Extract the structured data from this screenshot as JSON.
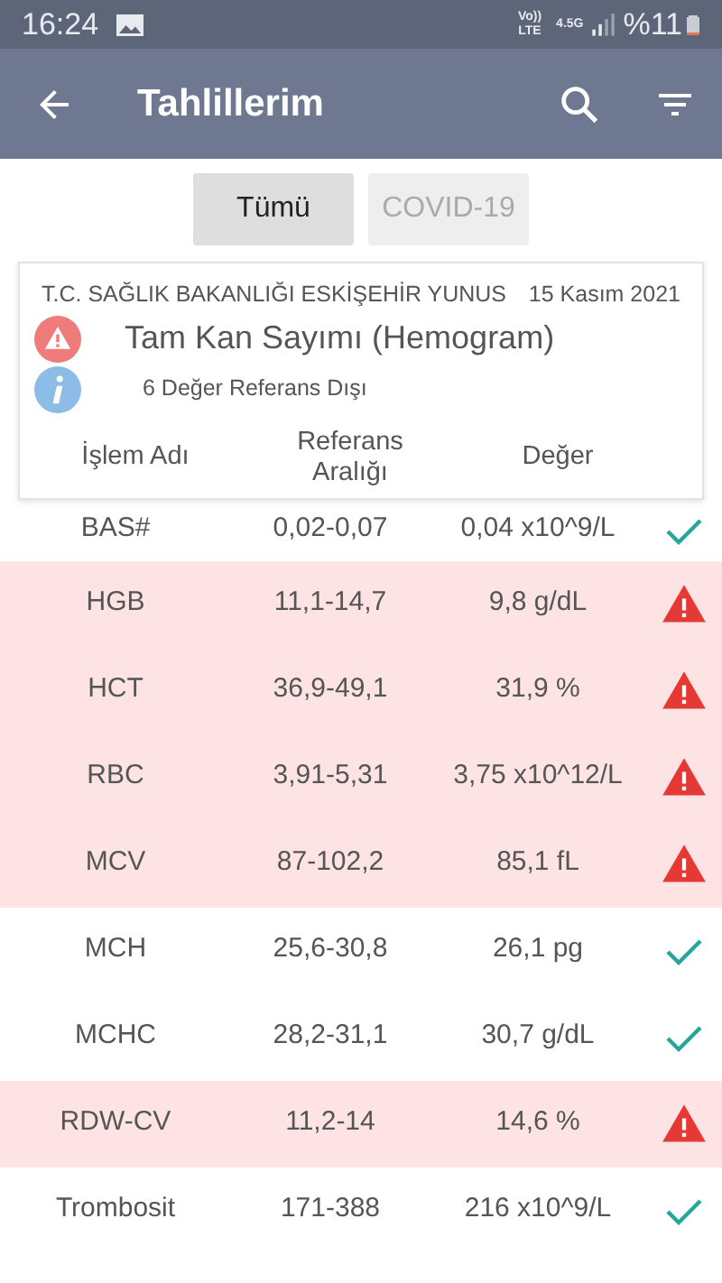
{
  "status_bar": {
    "time": "16:24",
    "volte": "Vo))",
    "lte": "LTE",
    "network": "4.5G",
    "battery": "%11"
  },
  "app_bar": {
    "title": "Tahlillerim"
  },
  "tabs": [
    {
      "label": "Tümü",
      "selected": true
    },
    {
      "label": "COVID-19",
      "selected": false
    }
  ],
  "card": {
    "institution": "T.C. SAĞLIK BAKANLIĞI ESKİŞEHİR YUNUS",
    "date": "15 Kasım 2021",
    "test_name": "Tam Kan Sayımı (Hemogram)",
    "summary": "6 Değer Referans Dışı",
    "columns": [
      "İşlem Adı",
      "Referans Aralığı",
      "Değer"
    ]
  },
  "rows": [
    {
      "name": "BAS#",
      "range": "0,02-0,07",
      "value": "0,04 x10^9/L",
      "out_of_range": false
    },
    {
      "name": "HGB",
      "range": "11,1-14,7",
      "value": "9,8 g/dL",
      "out_of_range": true
    },
    {
      "name": "HCT",
      "range": "36,9-49,1",
      "value": "31,9 %",
      "out_of_range": true
    },
    {
      "name": "RBC",
      "range": "3,91-5,31",
      "value": "3,75 x10^12/L",
      "out_of_range": true
    },
    {
      "name": "MCV",
      "range": "87-102,2",
      "value": "85,1 fL",
      "out_of_range": true
    },
    {
      "name": "MCH",
      "range": "25,6-30,8",
      "value": "26,1 pg",
      "out_of_range": false
    },
    {
      "name": "MCHC",
      "range": "28,2-31,1",
      "value": "30,7 g/dL",
      "out_of_range": false
    },
    {
      "name": "RDW-CV",
      "range": "11,2-14",
      "value": "14,6 %",
      "out_of_range": true
    },
    {
      "name": "Trombosit",
      "range": "171-388",
      "value": "216 x10^9/L",
      "out_of_range": false
    }
  ]
}
